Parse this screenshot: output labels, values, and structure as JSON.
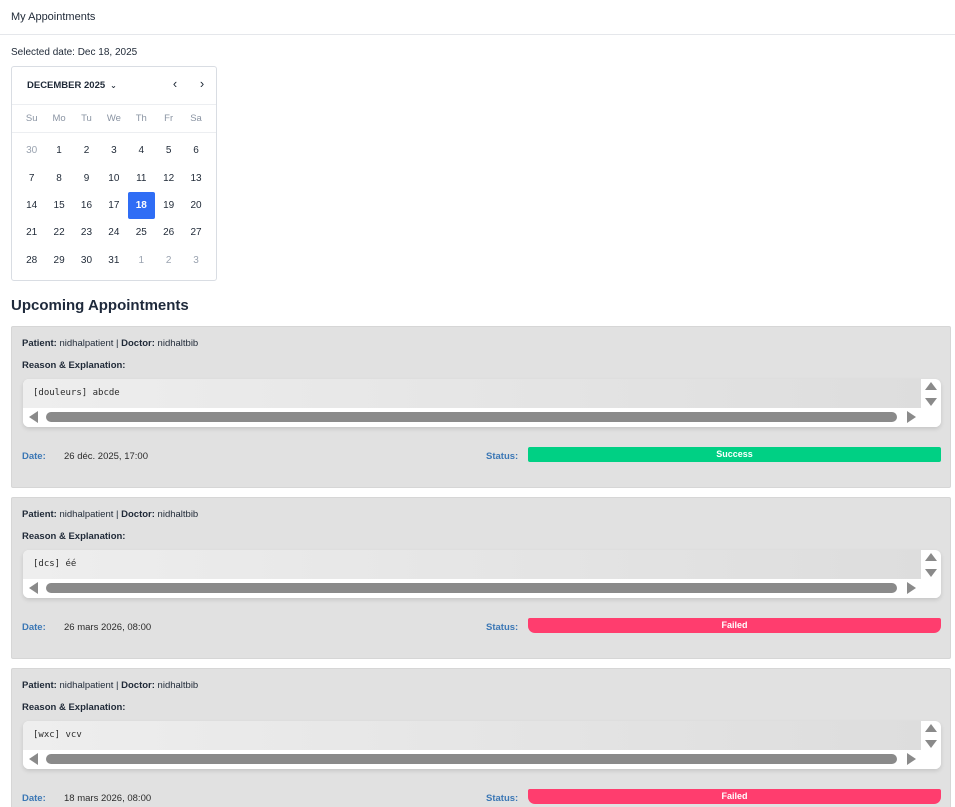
{
  "header": {
    "title": "My Appointments"
  },
  "selected_date_text": "Selected date: Dec 18, 2025",
  "calendar": {
    "month_label": "DECEMBER 2025",
    "prev_icon": "‹",
    "next_icon": "›",
    "weekdays": [
      "Su",
      "Mo",
      "Tu",
      "We",
      "Th",
      "Fr",
      "Sa"
    ],
    "weeks": [
      [
        {
          "d": "30",
          "m": true
        },
        {
          "d": "1"
        },
        {
          "d": "2"
        },
        {
          "d": "3"
        },
        {
          "d": "4"
        },
        {
          "d": "5"
        },
        {
          "d": "6"
        }
      ],
      [
        {
          "d": "7"
        },
        {
          "d": "8"
        },
        {
          "d": "9"
        },
        {
          "d": "10"
        },
        {
          "d": "11"
        },
        {
          "d": "12"
        },
        {
          "d": "13"
        }
      ],
      [
        {
          "d": "14"
        },
        {
          "d": "15"
        },
        {
          "d": "16"
        },
        {
          "d": "17"
        },
        {
          "d": "18",
          "s": true
        },
        {
          "d": "19"
        },
        {
          "d": "20"
        }
      ],
      [
        {
          "d": "21"
        },
        {
          "d": "22"
        },
        {
          "d": "23"
        },
        {
          "d": "24"
        },
        {
          "d": "25"
        },
        {
          "d": "26"
        },
        {
          "d": "27"
        }
      ],
      [
        {
          "d": "28"
        },
        {
          "d": "29"
        },
        {
          "d": "30"
        },
        {
          "d": "31"
        },
        {
          "d": "1",
          "m": true
        },
        {
          "d": "2",
          "m": true
        },
        {
          "d": "3",
          "m": true
        }
      ]
    ],
    "selected_color": "#2f6df5"
  },
  "section_title": "Upcoming Appointments",
  "labels": {
    "patient": "Patient:",
    "separator": " | ",
    "doctor": "Doctor:",
    "reason": "Reason & Explanation:",
    "date": "Date:",
    "status": "Status:"
  },
  "appointments": [
    {
      "patient": "nidhalpatient",
      "doctor": "nidhaltbib",
      "reason": "[douleurs] abcde",
      "date": "26 déc. 2025, 17:00",
      "status": "Success",
      "status_kind": "success"
    },
    {
      "patient": "nidhalpatient",
      "doctor": "nidhaltbib",
      "reason": "[dcs] éé",
      "date": "26 mars 2026, 08:00",
      "status": "Failed",
      "status_kind": "failed"
    },
    {
      "patient": "nidhalpatient",
      "doctor": "nidhaltbib",
      "reason": "[wxc] vcv",
      "date": "18 mars 2026, 08:00",
      "status": "Failed",
      "status_kind": "failed"
    }
  ],
  "colors": {
    "success": "#00d084",
    "failed": "#ff3d6e",
    "label_blue": "#3b77b5"
  }
}
